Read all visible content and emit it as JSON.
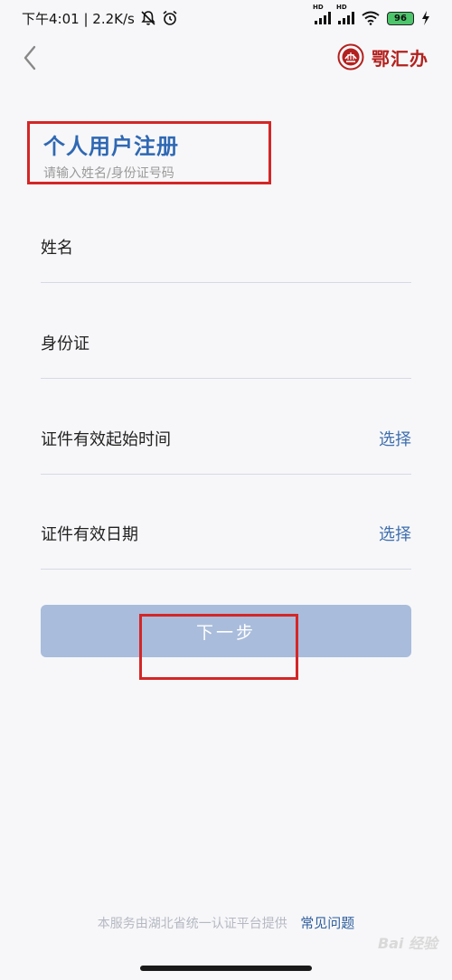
{
  "status_bar": {
    "time_speed": "下午4:01 | 2.2K/s",
    "hd1": "HD",
    "hd2": "HD",
    "battery": "96"
  },
  "header": {
    "logo_text": "鄂汇办"
  },
  "title": {
    "main": "个人用户注册",
    "subtitle": "请输入姓名/身份证号码"
  },
  "form": {
    "name_label": "姓名",
    "id_label": "身份证",
    "valid_start_label": "证件有效起始时间",
    "valid_start_action": "选择",
    "valid_end_label": "证件有效日期",
    "valid_end_action": "选择"
  },
  "next_button": "下一步",
  "footer": {
    "provider_text": "本服务由湖北省统一认证平台提供",
    "faq_link": "常见问题"
  },
  "watermark": "Bai 经验",
  "colors": {
    "title_blue": "#2f68b3",
    "button_disabled": "#a9bcdb",
    "highlight_red": "#d42626",
    "logo_red": "#b3211e"
  }
}
